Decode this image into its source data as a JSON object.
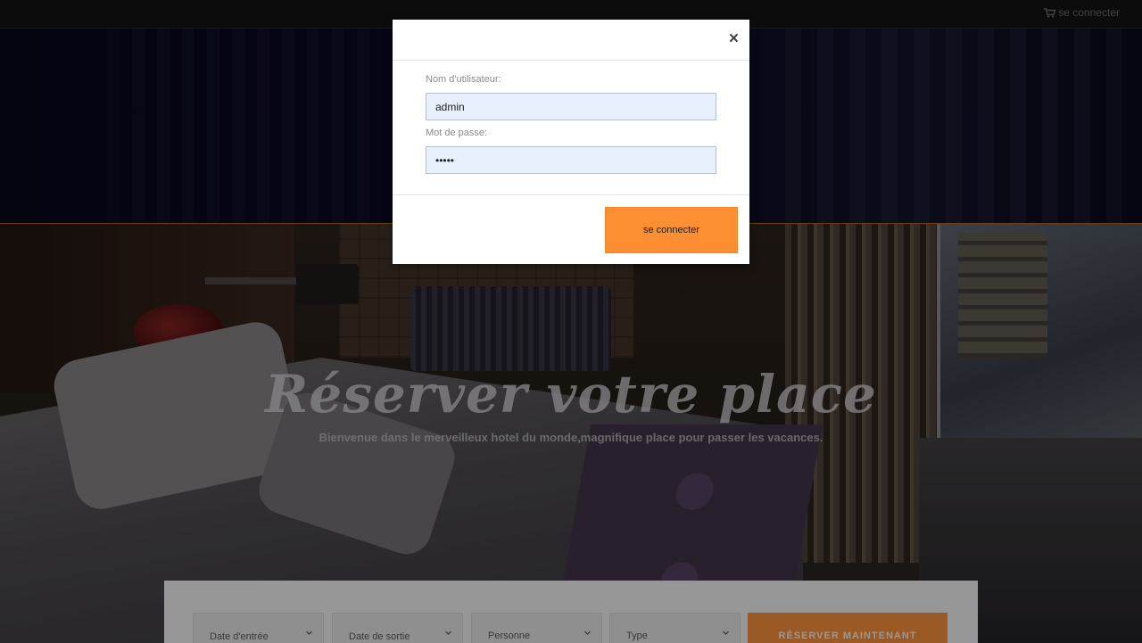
{
  "topbar": {
    "login_link": "se connecter",
    "cart_icon": "shopping-cart-icon"
  },
  "hero": {
    "title": "Réserver votre place",
    "subtitle": "Bienvenue dans le merveilleux hotel du monde,magnifique place pour passer les vacances."
  },
  "booking": {
    "checkin_placeholder": "Date d'entrée",
    "checkout_placeholder": "Date de sortie",
    "persons_placeholder": "Personne",
    "type_placeholder": "Type",
    "submit_label": "RÉSERVER MAINTENANT",
    "chevron_icon": "chevron-down-icon"
  },
  "modal": {
    "close_label": "×",
    "username_label": "Nom d'utilisateur:",
    "username_value": "admin",
    "password_label": "Mot de passe:",
    "password_value": "admin",
    "submit_label": "se connecter"
  },
  "colors": {
    "accent": "#fd8f33",
    "input_autofill": "#e8f0fe",
    "topbar": "#141414"
  }
}
